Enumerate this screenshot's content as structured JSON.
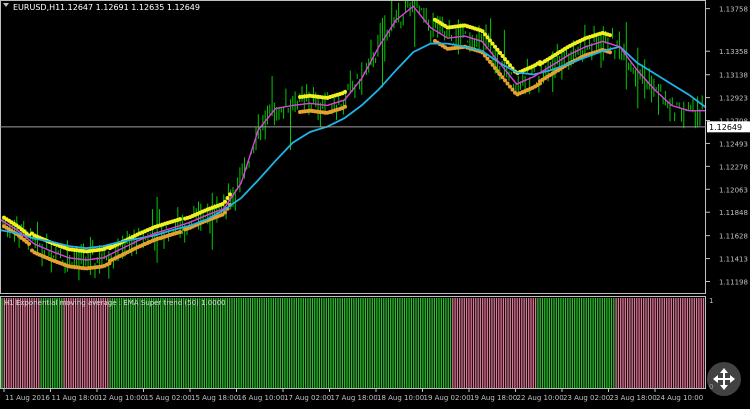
{
  "header": {
    "symbol": "EURUSD,H1",
    "ohlc": "1.12647 1.12691 1.12635 1.12649"
  },
  "indicator": {
    "label": "H1 Exponential moving average : EMA Super trend (50) 1.0000",
    "scale_top": "1",
    "scale_bottom": "0"
  },
  "price_label": "1.12649",
  "colors": {
    "background": "#000000",
    "bull_candle": "#00c800",
    "ma_fast": "#e040e0",
    "ma_slow": "#1eb4e6",
    "dots_upper": "#f0f020",
    "dots_lower": "#e6a030",
    "hist_up": "#2fbf2f",
    "hist_down": "#e07898",
    "axis": "#c0c0c0"
  },
  "chart_data": {
    "type": "line",
    "title": "EURUSD,H1",
    "ylim": [
      1.1109,
      1.1382
    ],
    "y_ticks": [
      "1.13758",
      "1.13358",
      "1.13138",
      "1.12923",
      "1.12708",
      "1.12493",
      "1.12278",
      "1.12063",
      "1.11848",
      "1.11628",
      "1.11413",
      "1.11198"
    ],
    "x_ticks": [
      "11 Aug 2016",
      "11 Aug 18:00",
      "12 Aug 10:00",
      "15 Aug 02:00",
      "15 Aug 18:00",
      "16 Aug 10:00",
      "17 Aug 02:00",
      "17 Aug 18:00",
      "18 Aug 10:00",
      "19 Aug 02:00",
      "19 Aug 18:00",
      "22 Aug 10:00",
      "23 Aug 02:00",
      "23 Aug 18:00",
      "24 Aug 10:00"
    ],
    "last_price": 1.12649,
    "series": [
      {
        "values": [
          1.1178,
          1.1168,
          1.1155,
          1.1148,
          1.1142,
          1.114,
          1.1142,
          1.115,
          1.1158,
          1.1165,
          1.117,
          1.1175,
          1.1182,
          1.1188,
          1.1212,
          1.1262,
          1.1282,
          1.1285,
          1.1287,
          1.1285,
          1.129,
          1.131,
          1.134,
          1.1365,
          1.1378,
          1.1358,
          1.1348,
          1.135,
          1.1345,
          1.1325,
          1.1305,
          1.1312,
          1.1322,
          1.1332,
          1.134,
          1.1345,
          1.134,
          1.1318,
          1.13,
          1.1285,
          1.128,
          1.128
        ]
      },
      {
        "values": [
          1.1168,
          1.1165,
          1.116,
          1.1157,
          1.1153,
          1.1151,
          1.1153,
          1.1157,
          1.116,
          1.1163,
          1.1168,
          1.1172,
          1.1178,
          1.1187,
          1.1198,
          1.1215,
          1.1233,
          1.125,
          1.126,
          1.1265,
          1.1273,
          1.1285,
          1.13,
          1.1318,
          1.1335,
          1.1343,
          1.1343,
          1.134,
          1.1336,
          1.1325,
          1.1316,
          1.1314,
          1.1318,
          1.1324,
          1.133,
          1.1336,
          1.134,
          1.1325,
          1.1315,
          1.1305,
          1.1295,
          1.1283
        ]
      }
    ]
  }
}
